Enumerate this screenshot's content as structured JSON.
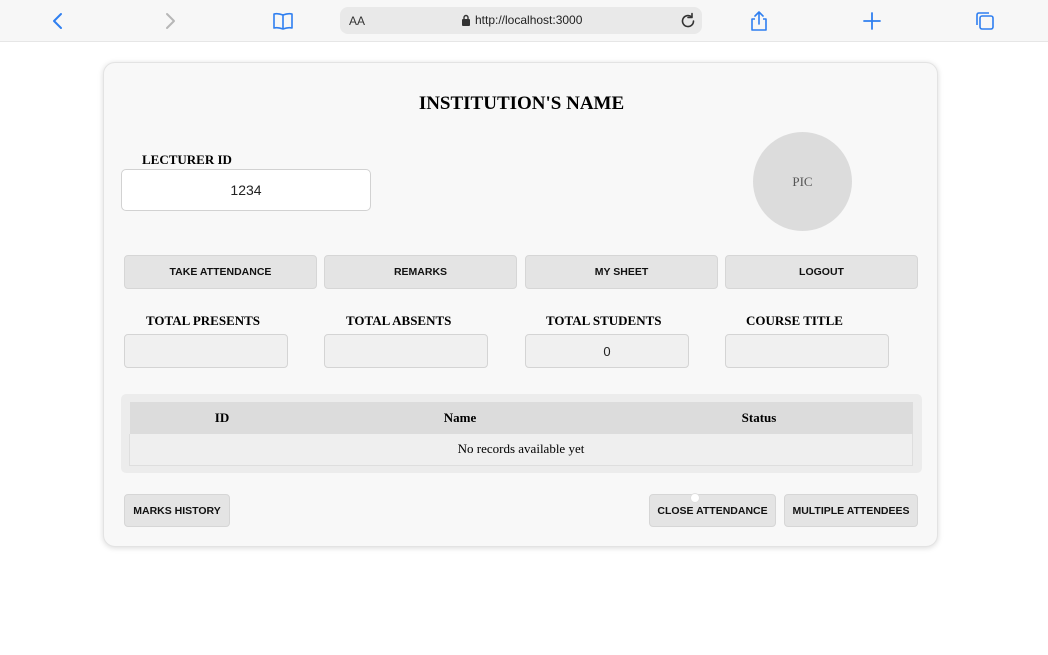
{
  "browser": {
    "text_size_label": "AA",
    "url": "http://localhost:3000"
  },
  "page": {
    "title": "INSTITUTION'S NAME",
    "lecturer_label": "LECTURER ID",
    "lecturer_id": "1234",
    "pic_label": "PIC"
  },
  "nav": {
    "take_attendance": "TAKE ATTENDANCE",
    "remarks": "REMARKS",
    "my_sheet": "MY SHEET",
    "logout": "LOGOUT"
  },
  "stats": [
    {
      "label": "TOTAL PRESENTS",
      "value": ""
    },
    {
      "label": "TOTAL ABSENTS",
      "value": ""
    },
    {
      "label": "TOTAL STUDENTS",
      "value": "0"
    },
    {
      "label": "COURSE TITLE",
      "value": ""
    }
  ],
  "table": {
    "headers": [
      "ID",
      "Name",
      "Status"
    ],
    "empty_message": "No records available yet"
  },
  "actions": {
    "marks_history": "MARKS HISTORY",
    "close_attendance": "CLOSE ATTENDANCE",
    "multiple_attendees": "MULTIPLE ATTENDEES"
  },
  "colors": {
    "browser_accent": "#2f7ff0",
    "card_bg": "#f8f8f8",
    "button_bg": "#e4e4e4"
  }
}
